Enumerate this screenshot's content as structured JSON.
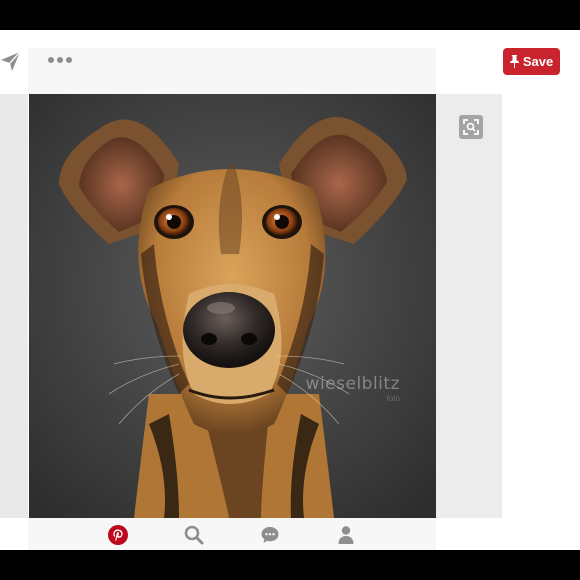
{
  "toolbar": {
    "send_icon": "send-icon",
    "more_icon": "more-options-icon",
    "save_label": "Save",
    "save_color": "#c9242e"
  },
  "pin": {
    "image_subject": "dog-portrait",
    "watermark": "wieselblitz",
    "watermark_sub": "foto",
    "visual_search_icon": "visual-search-icon"
  },
  "tab_bar": {
    "items": [
      {
        "icon": "pinterest-home-icon",
        "active": true,
        "color": "#bd081c"
      },
      {
        "icon": "search-icon",
        "active": false
      },
      {
        "icon": "messages-icon",
        "active": false
      },
      {
        "icon": "profile-icon",
        "active": false
      }
    ],
    "inactive_color": "#8e8e8e"
  },
  "colors": {
    "brand": "#c9242e",
    "background": "#ffffff",
    "letterbox": "#000000"
  }
}
